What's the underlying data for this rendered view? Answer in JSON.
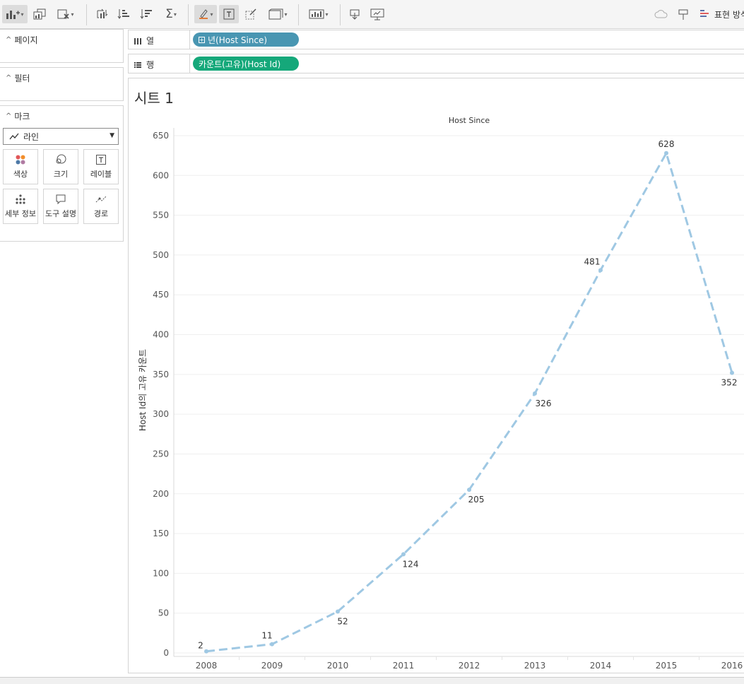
{
  "toolbar": {
    "buttons": [
      {
        "icon": "new-worksheet-icon",
        "active": true,
        "caret": true
      },
      {
        "icon": "duplicate-sheet-icon"
      },
      {
        "icon": "clear-sheet-icon",
        "caret": true
      },
      {
        "icon": "swap-rows-columns-icon"
      },
      {
        "icon": "sort-ascending-icon"
      },
      {
        "icon": "sort-descending-icon"
      },
      {
        "icon": "totals-sigma-icon",
        "caret": true
      },
      {
        "icon": "highlight-pen-icon",
        "active": true,
        "caret": true
      },
      {
        "icon": "show-mark-labels-icon",
        "active": true
      },
      {
        "icon": "format-workbook-icon"
      },
      {
        "icon": "fit-view-icon",
        "caret": true
      },
      {
        "icon": "show-cards-icon",
        "caret": true
      },
      {
        "icon": "download-icon"
      },
      {
        "icon": "presentation-mode-icon"
      }
    ],
    "show_me_label": "표현 방식"
  },
  "panes": {
    "pages": {
      "title": "페이지"
    },
    "filters": {
      "title": "필터"
    },
    "marks": {
      "title": "마크",
      "type": "라인",
      "cards": [
        {
          "label": "색상",
          "icon": "color-icon"
        },
        {
          "label": "크기",
          "icon": "size-icon"
        },
        {
          "label": "레이블",
          "icon": "label-icon"
        },
        {
          "label": "세부 정보",
          "icon": "detail-icon"
        },
        {
          "label": "도구 설명",
          "icon": "tooltip-icon"
        },
        {
          "label": "경로",
          "icon": "path-icon"
        }
      ]
    }
  },
  "shelves": {
    "columns": {
      "label": "열",
      "pill": "년(Host Since)"
    },
    "rows": {
      "label": "행",
      "pill": "카운트(고유)(Host Id)"
    }
  },
  "sheet": {
    "title": "시트 1"
  },
  "colors": {
    "line": "#9fc8e3",
    "columns_pill": "#4996b2",
    "rows_pill": "#15a87a"
  },
  "chart_data": {
    "type": "line",
    "title": "Host Since",
    "xlabel": "",
    "ylabel": "Host Id의 고유 카운트",
    "categories": [
      "2008",
      "2009",
      "2010",
      "2011",
      "2012",
      "2013",
      "2014",
      "2015",
      "2016"
    ],
    "values": [
      2,
      11,
      52,
      124,
      205,
      326,
      481,
      628,
      352
    ],
    "ylim": [
      0,
      650
    ],
    "yticks": [
      0,
      50,
      100,
      150,
      200,
      250,
      300,
      350,
      400,
      450,
      500,
      550,
      600,
      650
    ],
    "line_style": "dashed",
    "grid": true
  }
}
